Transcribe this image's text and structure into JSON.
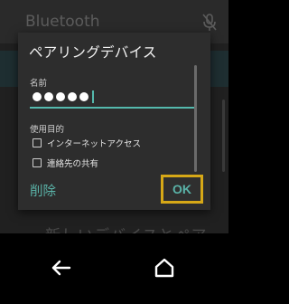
{
  "background": {
    "title": "Bluetooth",
    "partial_text": "新しいデバイスとペア"
  },
  "dialog": {
    "title": "ペアリングデバイス",
    "name_label": "名前",
    "pin_dot_count": 5,
    "usage_label": "使用目的",
    "options": [
      {
        "label": "インターネットアクセス",
        "checked": false
      },
      {
        "label": "連絡先の共有",
        "checked": false
      }
    ],
    "delete_label": "削除",
    "ok_label": "OK"
  },
  "colors": {
    "accent": "#54b9ad",
    "focus_highlight": "#d6a817",
    "dialog_bg": "#2d2d2d"
  },
  "icons": {
    "mic": "mic-off-icon",
    "back": "back-arrow-icon",
    "home": "home-icon"
  }
}
